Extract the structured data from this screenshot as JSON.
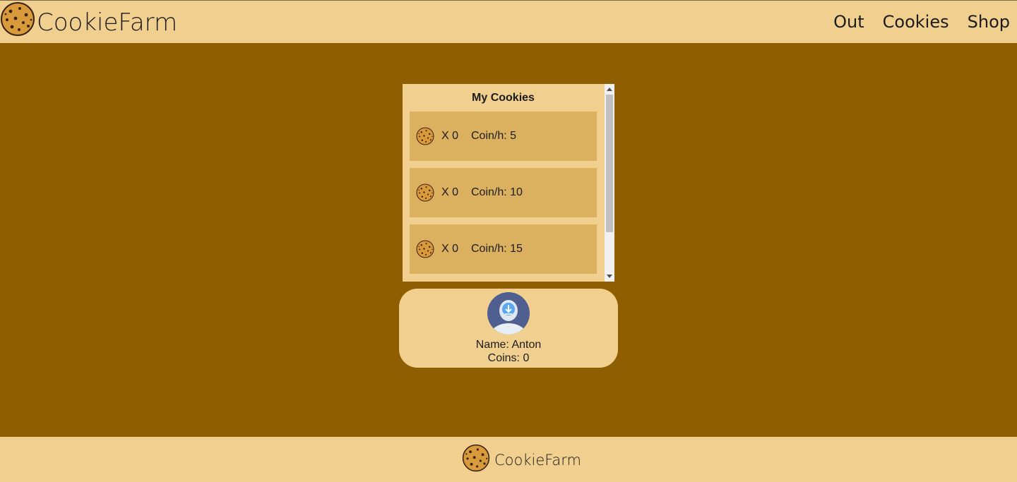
{
  "header": {
    "brand": "CookieFarm",
    "nav": [
      "Out",
      "Cookies",
      "Shop"
    ]
  },
  "panel": {
    "title": "My Cookies",
    "cards": [
      {
        "qty": "X 0",
        "rate": "Coin/h: 5"
      },
      {
        "qty": "X 0",
        "rate": "Coin/h: 10"
      },
      {
        "qty": "X 0",
        "rate": "Coin/h: 15"
      }
    ]
  },
  "profile": {
    "name": "Name: Anton",
    "coins": "Coins: 0"
  },
  "footer": {
    "brand": "CookieFarm"
  },
  "colors": {
    "background": "#8f5e00",
    "bar": "#f1cf8f",
    "card": "#dbb15f"
  },
  "icons": {
    "logo": "cookie-icon",
    "avatar": "avatar-icon"
  }
}
